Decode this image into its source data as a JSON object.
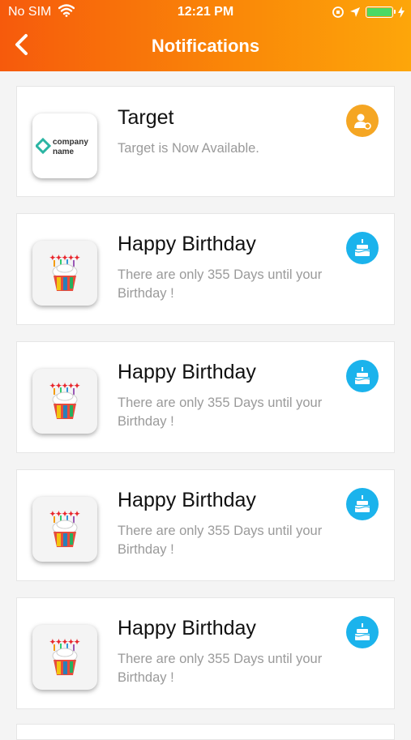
{
  "status_bar": {
    "carrier": "No SIM",
    "time": "12:21 PM",
    "battery_color": "#4cd964"
  },
  "header": {
    "title": "Notifications",
    "gradient": [
      "#f65a0c",
      "#fda60a"
    ]
  },
  "notifications": [
    {
      "title": "Target",
      "description": "Target is Now Available.",
      "thumb": "company-logo",
      "thumb_text": [
        "company",
        "name"
      ],
      "badge_icon": "user-add-icon",
      "badge_color": "#f5a623"
    },
    {
      "title": "Happy Birthday",
      "description": "There are only 355 Days until your Birthday !",
      "thumb": "birthday-cupcake",
      "badge_icon": "birthday-cake-icon",
      "badge_color": "#1bb3ec"
    },
    {
      "title": "Happy Birthday",
      "description": "There are only 355 Days until your Birthday !",
      "thumb": "birthday-cupcake",
      "badge_icon": "birthday-cake-icon",
      "badge_color": "#1bb3ec"
    },
    {
      "title": "Happy Birthday",
      "description": "There are only 355 Days until your Birthday !",
      "thumb": "birthday-cupcake",
      "badge_icon": "birthday-cake-icon",
      "badge_color": "#1bb3ec"
    },
    {
      "title": "Happy Birthday",
      "description": "There are only 355 Days until your Birthday !",
      "thumb": "birthday-cupcake",
      "badge_icon": "birthday-cake-icon",
      "badge_color": "#1bb3ec"
    }
  ]
}
